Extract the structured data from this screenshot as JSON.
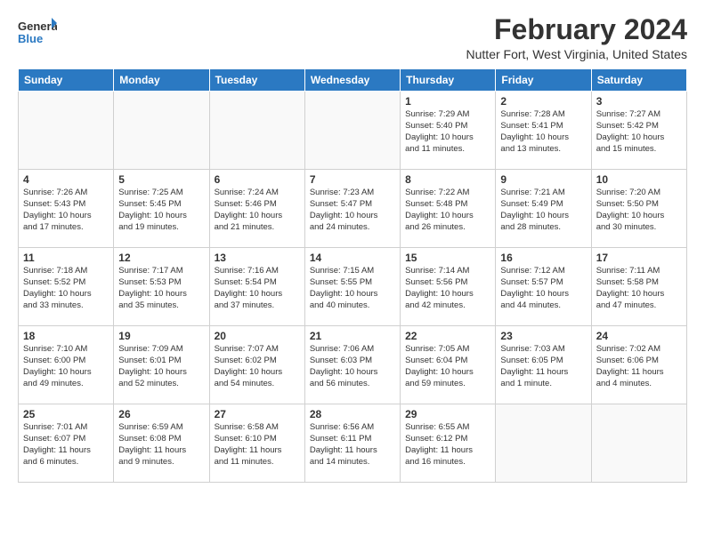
{
  "header": {
    "logo_line1": "General",
    "logo_line2": "Blue",
    "main_title": "February 2024",
    "subtitle": "Nutter Fort, West Virginia, United States"
  },
  "days_of_week": [
    "Sunday",
    "Monday",
    "Tuesday",
    "Wednesday",
    "Thursday",
    "Friday",
    "Saturday"
  ],
  "weeks": [
    [
      {
        "num": "",
        "text": ""
      },
      {
        "num": "",
        "text": ""
      },
      {
        "num": "",
        "text": ""
      },
      {
        "num": "",
        "text": ""
      },
      {
        "num": "1",
        "text": "Sunrise: 7:29 AM\nSunset: 5:40 PM\nDaylight: 10 hours\nand 11 minutes."
      },
      {
        "num": "2",
        "text": "Sunrise: 7:28 AM\nSunset: 5:41 PM\nDaylight: 10 hours\nand 13 minutes."
      },
      {
        "num": "3",
        "text": "Sunrise: 7:27 AM\nSunset: 5:42 PM\nDaylight: 10 hours\nand 15 minutes."
      }
    ],
    [
      {
        "num": "4",
        "text": "Sunrise: 7:26 AM\nSunset: 5:43 PM\nDaylight: 10 hours\nand 17 minutes."
      },
      {
        "num": "5",
        "text": "Sunrise: 7:25 AM\nSunset: 5:45 PM\nDaylight: 10 hours\nand 19 minutes."
      },
      {
        "num": "6",
        "text": "Sunrise: 7:24 AM\nSunset: 5:46 PM\nDaylight: 10 hours\nand 21 minutes."
      },
      {
        "num": "7",
        "text": "Sunrise: 7:23 AM\nSunset: 5:47 PM\nDaylight: 10 hours\nand 24 minutes."
      },
      {
        "num": "8",
        "text": "Sunrise: 7:22 AM\nSunset: 5:48 PM\nDaylight: 10 hours\nand 26 minutes."
      },
      {
        "num": "9",
        "text": "Sunrise: 7:21 AM\nSunset: 5:49 PM\nDaylight: 10 hours\nand 28 minutes."
      },
      {
        "num": "10",
        "text": "Sunrise: 7:20 AM\nSunset: 5:50 PM\nDaylight: 10 hours\nand 30 minutes."
      }
    ],
    [
      {
        "num": "11",
        "text": "Sunrise: 7:18 AM\nSunset: 5:52 PM\nDaylight: 10 hours\nand 33 minutes."
      },
      {
        "num": "12",
        "text": "Sunrise: 7:17 AM\nSunset: 5:53 PM\nDaylight: 10 hours\nand 35 minutes."
      },
      {
        "num": "13",
        "text": "Sunrise: 7:16 AM\nSunset: 5:54 PM\nDaylight: 10 hours\nand 37 minutes."
      },
      {
        "num": "14",
        "text": "Sunrise: 7:15 AM\nSunset: 5:55 PM\nDaylight: 10 hours\nand 40 minutes."
      },
      {
        "num": "15",
        "text": "Sunrise: 7:14 AM\nSunset: 5:56 PM\nDaylight: 10 hours\nand 42 minutes."
      },
      {
        "num": "16",
        "text": "Sunrise: 7:12 AM\nSunset: 5:57 PM\nDaylight: 10 hours\nand 44 minutes."
      },
      {
        "num": "17",
        "text": "Sunrise: 7:11 AM\nSunset: 5:58 PM\nDaylight: 10 hours\nand 47 minutes."
      }
    ],
    [
      {
        "num": "18",
        "text": "Sunrise: 7:10 AM\nSunset: 6:00 PM\nDaylight: 10 hours\nand 49 minutes."
      },
      {
        "num": "19",
        "text": "Sunrise: 7:09 AM\nSunset: 6:01 PM\nDaylight: 10 hours\nand 52 minutes."
      },
      {
        "num": "20",
        "text": "Sunrise: 7:07 AM\nSunset: 6:02 PM\nDaylight: 10 hours\nand 54 minutes."
      },
      {
        "num": "21",
        "text": "Sunrise: 7:06 AM\nSunset: 6:03 PM\nDaylight: 10 hours\nand 56 minutes."
      },
      {
        "num": "22",
        "text": "Sunrise: 7:05 AM\nSunset: 6:04 PM\nDaylight: 10 hours\nand 59 minutes."
      },
      {
        "num": "23",
        "text": "Sunrise: 7:03 AM\nSunset: 6:05 PM\nDaylight: 11 hours\nand 1 minute."
      },
      {
        "num": "24",
        "text": "Sunrise: 7:02 AM\nSunset: 6:06 PM\nDaylight: 11 hours\nand 4 minutes."
      }
    ],
    [
      {
        "num": "25",
        "text": "Sunrise: 7:01 AM\nSunset: 6:07 PM\nDaylight: 11 hours\nand 6 minutes."
      },
      {
        "num": "26",
        "text": "Sunrise: 6:59 AM\nSunset: 6:08 PM\nDaylight: 11 hours\nand 9 minutes."
      },
      {
        "num": "27",
        "text": "Sunrise: 6:58 AM\nSunset: 6:10 PM\nDaylight: 11 hours\nand 11 minutes."
      },
      {
        "num": "28",
        "text": "Sunrise: 6:56 AM\nSunset: 6:11 PM\nDaylight: 11 hours\nand 14 minutes."
      },
      {
        "num": "29",
        "text": "Sunrise: 6:55 AM\nSunset: 6:12 PM\nDaylight: 11 hours\nand 16 minutes."
      },
      {
        "num": "",
        "text": ""
      },
      {
        "num": "",
        "text": ""
      }
    ]
  ]
}
